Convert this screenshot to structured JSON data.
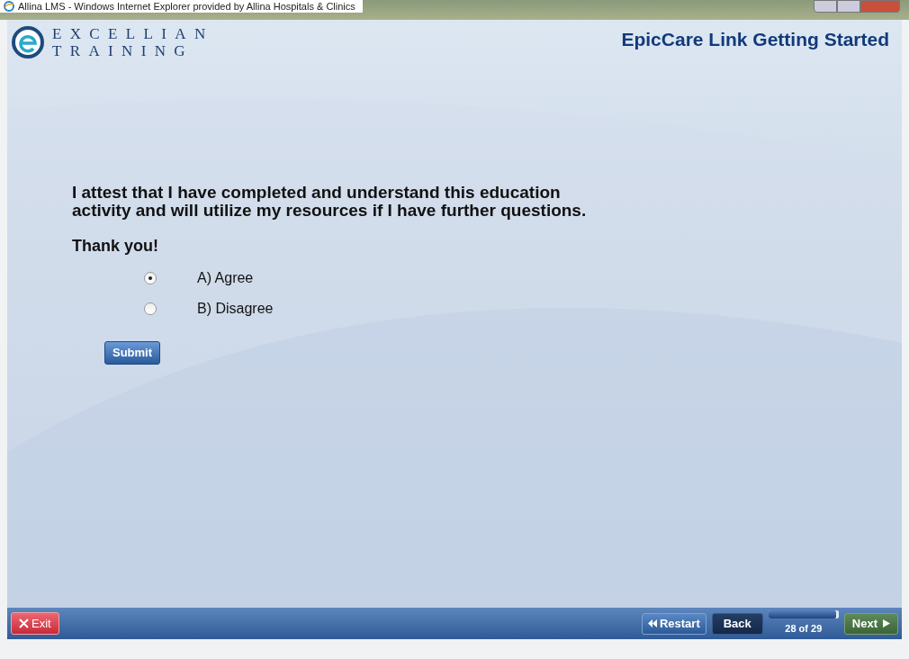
{
  "window": {
    "title": "Allina LMS - Windows Internet Explorer provided by Allina Hospitals & Clinics"
  },
  "logo": {
    "line1": "EXCELLIAN",
    "line2": "TRAINING"
  },
  "course_title": "EpicCare Link Getting Started",
  "question": {
    "text": "I attest that I have completed and understand this education activity and will utilize my resources if I have further questions.",
    "thanks": "Thank you!"
  },
  "options": [
    {
      "label": "A) Agree",
      "selected": true
    },
    {
      "label": "B) Disagree",
      "selected": false
    }
  ],
  "submit": "Submit",
  "footer": {
    "exit": "Exit",
    "restart": "Restart",
    "back": "Back",
    "progress": {
      "level": 0.97,
      "label": "28 of 29"
    },
    "next": "Next"
  }
}
